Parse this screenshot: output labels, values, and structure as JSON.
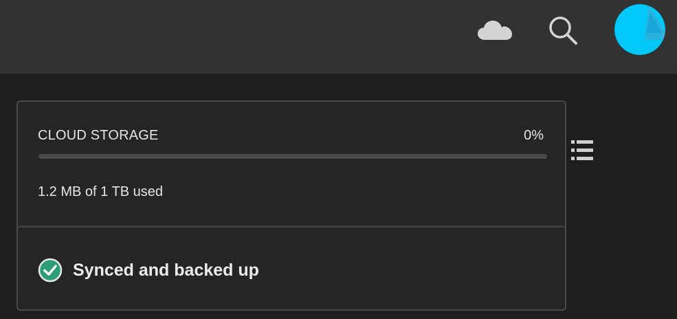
{
  "header": {
    "icons": [
      "cloud-icon",
      "search-icon",
      "avatar"
    ]
  },
  "storage": {
    "title": "CLOUD STORAGE",
    "percent_label": "0%",
    "progress_fraction": 0.0,
    "used_label": "1.2 MB of 1 TB used"
  },
  "sync": {
    "status_label": "Synced and backed up",
    "status_icon": "check-circle-icon"
  },
  "side": {
    "icon": "list-view-icon"
  },
  "colors": {
    "topbar": "#323232",
    "background": "#1e1e1e",
    "avatar": "#00c8f8",
    "check": "#2d9d78",
    "progress_fill": "#1473e6"
  }
}
